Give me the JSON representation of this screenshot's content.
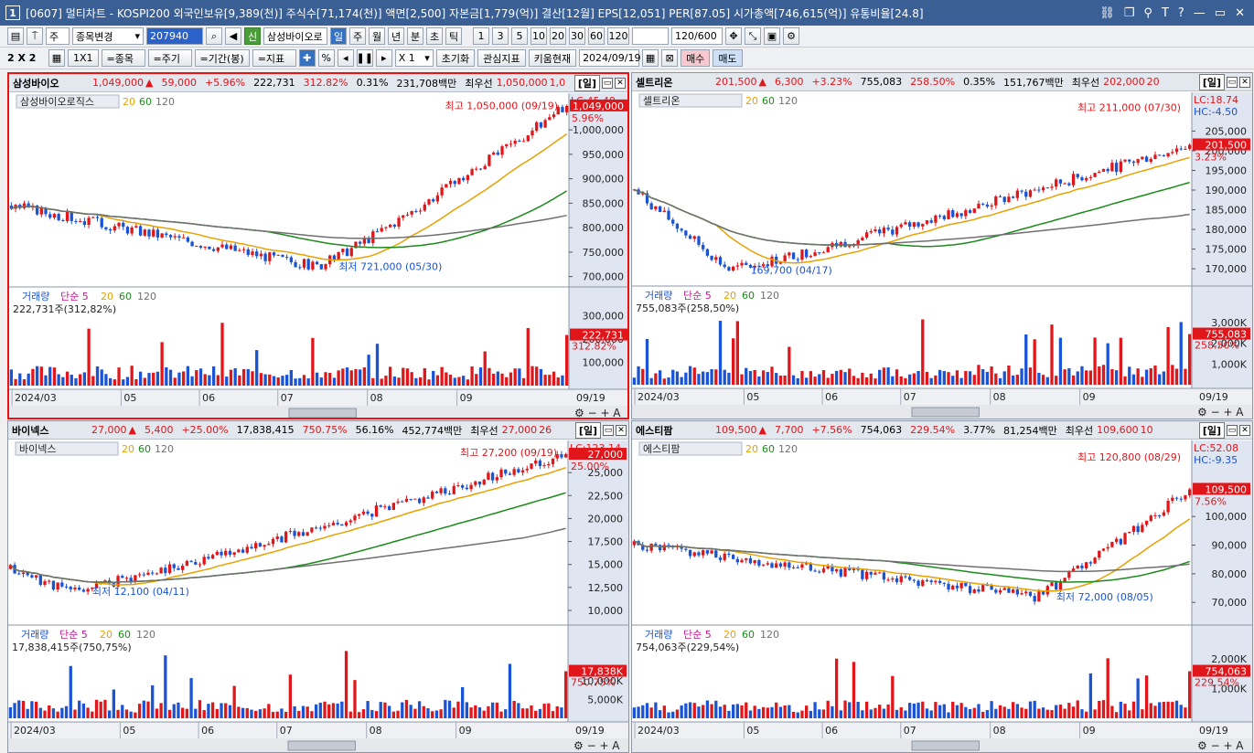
{
  "window": {
    "title": "[0607] 멀티차트 - KOSPI200 외국인보유[9,389(천)] 주식수[71,174(천)] 액면[2,500] 자본금[1,779(억)] 결산[12월] EPS[12,051] PER[87.05] 시가총액[746,615(억)] 유통비율[24.8]",
    "app_number": "1"
  },
  "toolbar1": {
    "sub": "주",
    "mode": "종목변경",
    "code": "207940",
    "stock_name": "삼성바이오로",
    "periods": [
      "일",
      "주",
      "월",
      "년",
      "분",
      "초",
      "틱"
    ],
    "active_period": "일",
    "intervals": [
      "1",
      "3",
      "5",
      "10",
      "20",
      "30",
      "60",
      "120"
    ],
    "count": "120/600",
    "new_label": "신"
  },
  "toolbar2": {
    "layout": "2 X 2",
    "one": "1X1",
    "b_stock": "=종목",
    "b_period": "=주기",
    "b_range": "=기간(봉)",
    "b_index": "=지표",
    "plus": "✚",
    "pct": "%",
    "mult": "X 1",
    "reset": "초기화",
    "fav_index": "관심지표",
    "kiwoom": "키움현재",
    "date": "2024/09/19",
    "buy": "매수",
    "sell": "매도"
  },
  "axis_dates": [
    "2024/03",
    "05",
    "06",
    "07",
    "08",
    "09",
    "09/19"
  ],
  "colors": {
    "up": "#e0161b",
    "down": "#1a53d4",
    "ma20": "#e8a100",
    "ma60": "#1c8a1c",
    "ma120": "#707070",
    "ma5": "#c2188f"
  },
  "panels": [
    {
      "id": "p1",
      "name": "삼성바이오",
      "price": "1,049,000",
      "sign": "▲",
      "change": "59,000",
      "rate": "+5.96%",
      "volume": "222,731",
      "vol_rate": "312.82%",
      "turn": "0.31%",
      "amount": "231,708백만",
      "best_label": "최우선",
      "best": "1,050,000",
      "best2": "1,0",
      "day": "[일]",
      "legend_name": "삼성바이오로직스",
      "ma": [
        "20",
        "60",
        "120"
      ],
      "lc": "LC:45.49",
      "hc": "",
      "high_note": "최고 1,050,000 (09/19)",
      "low_note": "최저 721,000 (05/30)",
      "last_box": "1,049,000",
      "last_rate": "5.96%",
      "yticks": [
        "1,000,000",
        "950,000",
        "900,000",
        "850,000",
        "800,000",
        "750,000",
        "700,000"
      ],
      "ymin": 690000,
      "ymax": 1060000,
      "start": 845000,
      "end": 1049000,
      "low": 721000,
      "lowIdx": 0.55,
      "high": 1050000,
      "vol_title": "거래량",
      "vol_ma": "단순 5",
      "vol_ma_n": [
        "20",
        "60",
        "120"
      ],
      "vol_info": "222,731주(312,82%)",
      "vol_ticks": [
        "300,000",
        "200,000",
        "100,000"
      ],
      "vol_box": "222,731",
      "vol_box_rate": "312.82%",
      "seed": 3,
      "volmax": 330000
    },
    {
      "id": "p2",
      "name": "셀트리온",
      "price": "201,500",
      "sign": "▲",
      "change": "6,300",
      "rate": "+3.23%",
      "volume": "755,083",
      "vol_rate": "258.50%",
      "turn": "0.35%",
      "amount": "151,767백만",
      "best_label": "최우선",
      "best": "202,000",
      "best2": "20",
      "day": "[일]",
      "legend_name": "셀트리온",
      "ma": [
        "20",
        "60",
        "120"
      ],
      "lc": "LC:18.74",
      "hc": "HC:-4.50",
      "high_note": "최고 211,000 (07/30)",
      "low_note": "169,700 (04/17)",
      "last_box": "201,500",
      "last_rate": "3.23%",
      "yticks": [
        "205,000",
        "200,000",
        "195,000",
        "190,000",
        "185,000",
        "180,000",
        "175,000",
        "170,000"
      ],
      "ymin": 167000,
      "ymax": 213000,
      "start": 190000,
      "end": 201500,
      "low": 169700,
      "lowIdx": 0.17,
      "high": 211000,
      "vol_title": "거래량",
      "vol_ma": "단순 5",
      "vol_ma_n": [
        "20",
        "60",
        "120"
      ],
      "vol_info": "755,083주(258,50%)",
      "vol_ticks": [
        "3,000K",
        "2,000K",
        "1,000K"
      ],
      "vol_box": "755,083",
      "vol_box_rate": "258.50%",
      "seed": 7,
      "volmax": 3700000
    },
    {
      "id": "p3",
      "name": "바이넥스",
      "price": "27,000",
      "sign": "▲",
      "change": "5,400",
      "rate": "+25.00%",
      "volume": "17,838,415",
      "vol_rate": "750.75%",
      "turn": "56.16%",
      "amount": "452,774백만",
      "best_label": "최우선",
      "best": "27,000",
      "best2": "26",
      "day": "[일]",
      "legend_name": "바이넥스",
      "ma": [
        "20",
        "60",
        "120"
      ],
      "lc": "LC:123.14",
      "hc": "",
      "high_note": "최고 27,200 (09/19)",
      "low_note": "최저 12,100 (04/11)",
      "last_box": "27,000",
      "last_rate": "25.00%",
      "yticks": [
        "25,000",
        "22,500",
        "20,000",
        "17,500",
        "15,000",
        "12,500",
        "10,000"
      ],
      "ymin": 9000,
      "ymax": 27700,
      "start": 14500,
      "end": 27000,
      "low": 12100,
      "lowIdx": 0.11,
      "high": 27200,
      "vol_title": "거래량",
      "vol_ma": "단순 5",
      "vol_ma_n": [
        "20",
        "60",
        "120"
      ],
      "vol_info": "17,838,415주(750,75%)",
      "vol_ticks": [
        "10,000K",
        "5,000K"
      ],
      "vol_box": "17,838K",
      "vol_box_rate": "750.75%",
      "seed": 11,
      "volmax": 19000000
    },
    {
      "id": "p4",
      "name": "에스티팜",
      "price": "109,500",
      "sign": "▲",
      "change": "7,700",
      "rate": "+7.56%",
      "volume": "754,063",
      "vol_rate": "229.54%",
      "turn": "3.77%",
      "amount": "81,254백만",
      "best_label": "최우선",
      "best": "109,600",
      "best2": "10",
      "day": "[일]",
      "legend_name": "에스티팜",
      "ma": [
        "20",
        "60",
        "120"
      ],
      "lc": "LC:52.08",
      "hc": "HC:-9.35",
      "high_note": "최고 120,800 (08/29)",
      "low_note": "최저 72,000 (08/05)",
      "last_box": "109,500",
      "last_rate": "7.56%",
      "yticks": [
        "100,000",
        "90,000",
        "80,000",
        "70,000"
      ],
      "ymin": 64000,
      "ymax": 124000,
      "start": 90000,
      "end": 109500,
      "low": 72000,
      "lowIdx": 0.72,
      "high": 120800,
      "vol_title": "거래량",
      "vol_ma": "단순 5",
      "vol_ma_n": [
        "20",
        "60",
        "120"
      ],
      "vol_info": "754,063주(229,54%)",
      "vol_ticks": [
        "2,000K",
        "1,000K"
      ],
      "vol_box": "754,063",
      "vol_box_rate": "229.54%",
      "seed": 5,
      "volmax": 2400000
    }
  ]
}
